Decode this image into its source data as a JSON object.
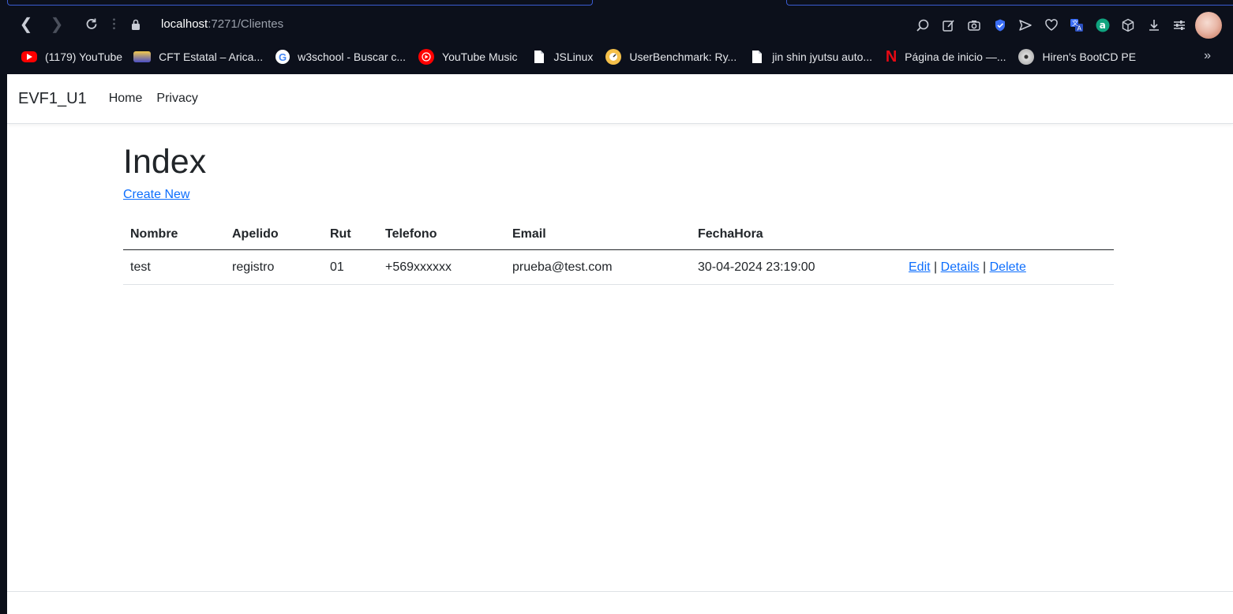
{
  "browser": {
    "url_host": "localhost",
    "url_path": ":7271/Clientes",
    "bookmarks": [
      {
        "label": "(1179) YouTube",
        "icon": "youtube-icon"
      },
      {
        "label": "CFT Estatal – Arica...",
        "icon": "cft-logo-icon"
      },
      {
        "label": "w3school - Buscar c...",
        "icon": "google-icon"
      },
      {
        "label": "YouTube Music",
        "icon": "youtube-music-icon"
      },
      {
        "label": "JSLinux",
        "icon": "file-icon"
      },
      {
        "label": "UserBenchmark: Ry...",
        "icon": "userbenchmark-icon"
      },
      {
        "label": "jin shin jyutsu auto...",
        "icon": "file-icon"
      },
      {
        "label": "Página de inicio —...",
        "icon": "netflix-icon"
      },
      {
        "label": "Hiren's BootCD PE",
        "icon": "cd-icon"
      }
    ]
  },
  "app": {
    "brand": "EVF1_U1",
    "nav": {
      "home": "Home",
      "privacy": "Privacy"
    }
  },
  "page": {
    "title": "Index",
    "create_link": "Create New",
    "columns": [
      "Nombre",
      "Apelido",
      "Rut",
      "Telefono",
      "Email",
      "FechaHora"
    ],
    "rows": [
      {
        "nombre": "test",
        "apellido": "registro",
        "rut": "01",
        "telefono": "+569xxxxxx",
        "email": "prueba@test.com",
        "fechahora": "30-04-2024 23:19:00",
        "actions": {
          "edit": "Edit",
          "details": "Details",
          "delete": "Delete",
          "separator": "|"
        }
      }
    ]
  },
  "colors": {
    "chrome_bg": "#0c101b",
    "link": "#0d6efd",
    "text": "#212529"
  }
}
